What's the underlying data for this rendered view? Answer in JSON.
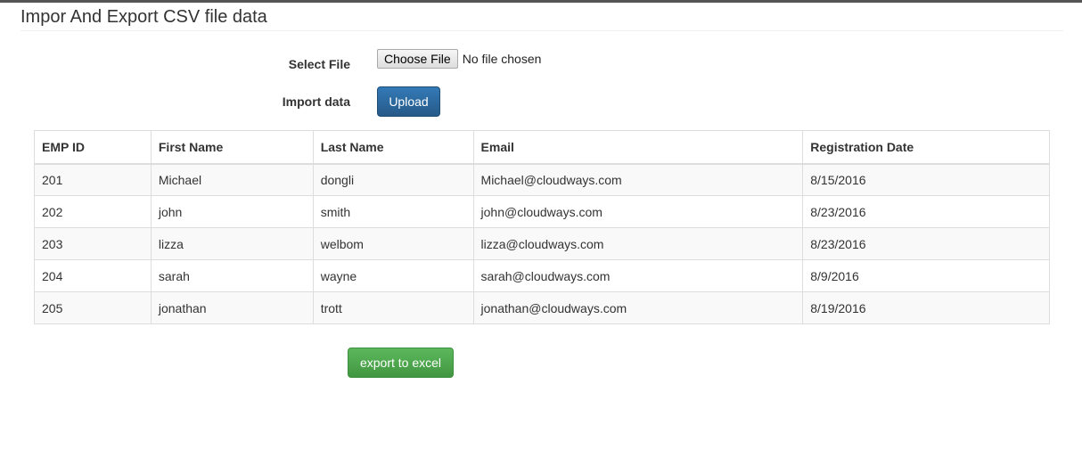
{
  "page": {
    "title": "Impor And Export CSV file data"
  },
  "form": {
    "select_file_label": "Select File",
    "choose_file_button": "Choose File",
    "file_status": "No file chosen",
    "import_label": "Import data",
    "upload_button": "Upload"
  },
  "table": {
    "headers": [
      "EMP ID",
      "First Name",
      "Last Name",
      "Email",
      "Registration Date"
    ],
    "rows": [
      [
        "201",
        "Michael",
        "dongli",
        "Michael@cloudways.com",
        "8/15/2016"
      ],
      [
        "202",
        "john",
        "smith",
        "john@cloudways.com",
        "8/23/2016"
      ],
      [
        "203",
        "lizza",
        "welbom",
        "lizza@cloudways.com",
        "8/23/2016"
      ],
      [
        "204",
        "sarah",
        "wayne",
        "sarah@cloudways.com",
        "8/9/2016"
      ],
      [
        "205",
        "jonathan",
        "trott",
        "jonathan@cloudways.com",
        "8/19/2016"
      ]
    ]
  },
  "actions": {
    "export_button": "export to excel"
  },
  "colors": {
    "primary": "#337ab7",
    "success": "#5cb85c",
    "stripe": "#f9f9f9",
    "border": "#dddddd"
  }
}
